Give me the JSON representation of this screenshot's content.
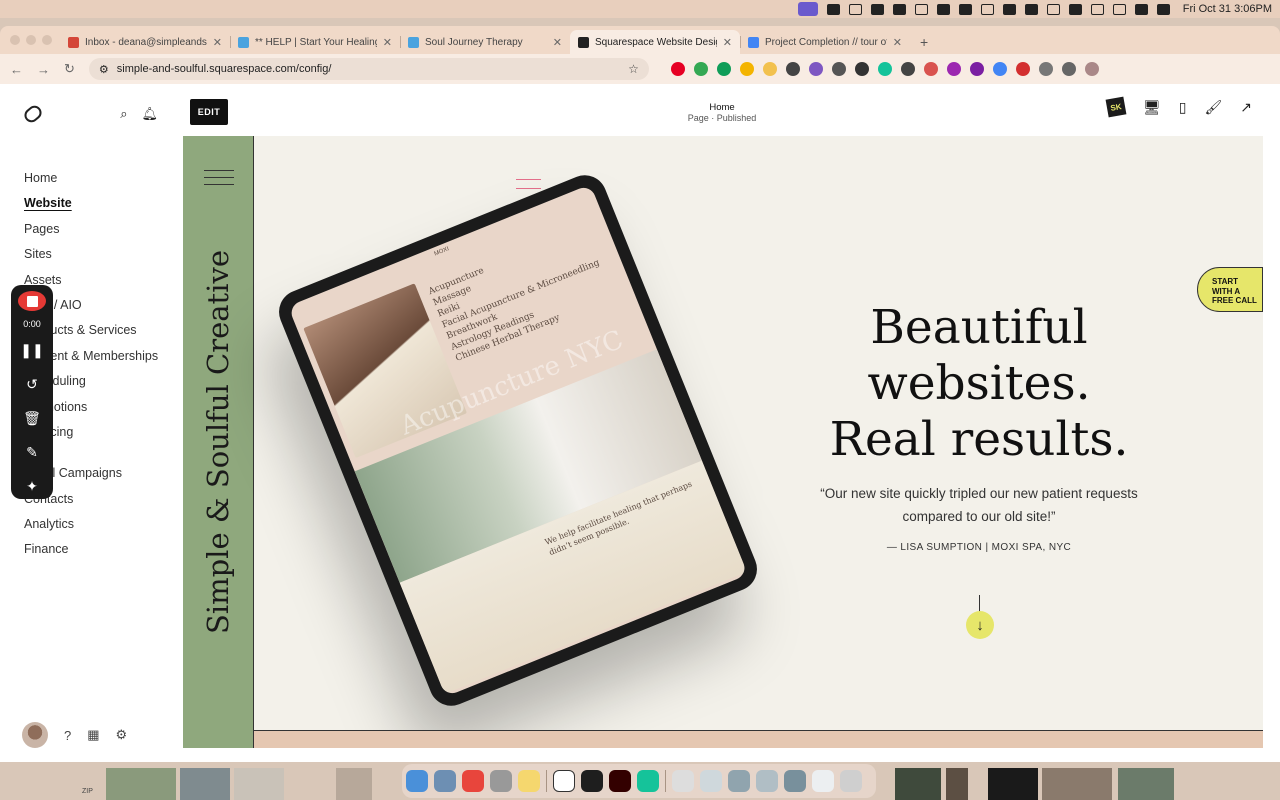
{
  "menubar": {
    "clock": "Fri Oct 31  3:06PM"
  },
  "browser": {
    "tabs": [
      {
        "title": "Inbox - deana@simpleandsoulful.com",
        "favicon_color": "#d44638"
      },
      {
        "title": "** HELP | Start Your Healing",
        "favicon_color": "#4aa3df"
      },
      {
        "title": "Soul Journey Therapy",
        "favicon_color": "#4aa3df"
      },
      {
        "title": "Squarespace Website Design",
        "favicon_color": "#222222"
      },
      {
        "title": "Project Completion // tour of",
        "favicon_color": "#4285f4"
      }
    ],
    "active_tab_index": 3,
    "new_tab": "+",
    "url": "simple-and-soulful.squarespace.com/config/"
  },
  "sidebar": {
    "items": [
      {
        "label": "Home"
      },
      {
        "label": "Website"
      },
      {
        "label": "Pages"
      },
      {
        "label": "Sites"
      },
      {
        "label": "Assets"
      },
      {
        "label": "SEO / AIO"
      },
      {
        "label": "Products & Services"
      },
      {
        "label": "Content & Memberships"
      },
      {
        "label": "Scheduling"
      },
      {
        "label": "Promotions"
      },
      {
        "label": "Invoicing"
      }
    ],
    "secondary": [
      {
        "label": "Email Campaigns"
      },
      {
        "label": "Contacts"
      },
      {
        "label": "Analytics"
      },
      {
        "label": "Finance"
      }
    ],
    "active": "Website"
  },
  "recorder": {
    "time": "0:00"
  },
  "editor": {
    "edit_label": "EDIT",
    "page_title": "Home",
    "page_status": "Page · Published",
    "sk_badge": "SK"
  },
  "site": {
    "brand": "Simple & Soulful Creative",
    "headline_1": "Beautiful",
    "headline_2": "websites.",
    "headline_3": "Real results.",
    "quote": "“Our new site quickly tripled our new patient requests compared to our old site!”",
    "attribution": "— LISA SUMPTION | MOXI SPA, NYC",
    "cta_1": "START",
    "cta_2": "WITH A",
    "cta_3": "FREE CALL",
    "mock": {
      "logo": "MOXI",
      "services": [
        "Acupuncture",
        "Massage",
        "Reiki",
        "Facial Acupuncture & Microneedling",
        "Breathwork",
        "Astrology Readings",
        "Chinese Herbal Therapy"
      ],
      "watermark": "Acupuncture NYC",
      "tagline": "We help facilitate healing that perhaps didn’t seem possible."
    }
  },
  "colors": {
    "accent_green": "#8fa87d",
    "accent_yellow": "#e6e66a",
    "canvas_bg": "#f3f1ea",
    "record_red": "#e53935"
  },
  "dock": {
    "zip_label": "ZIP"
  }
}
